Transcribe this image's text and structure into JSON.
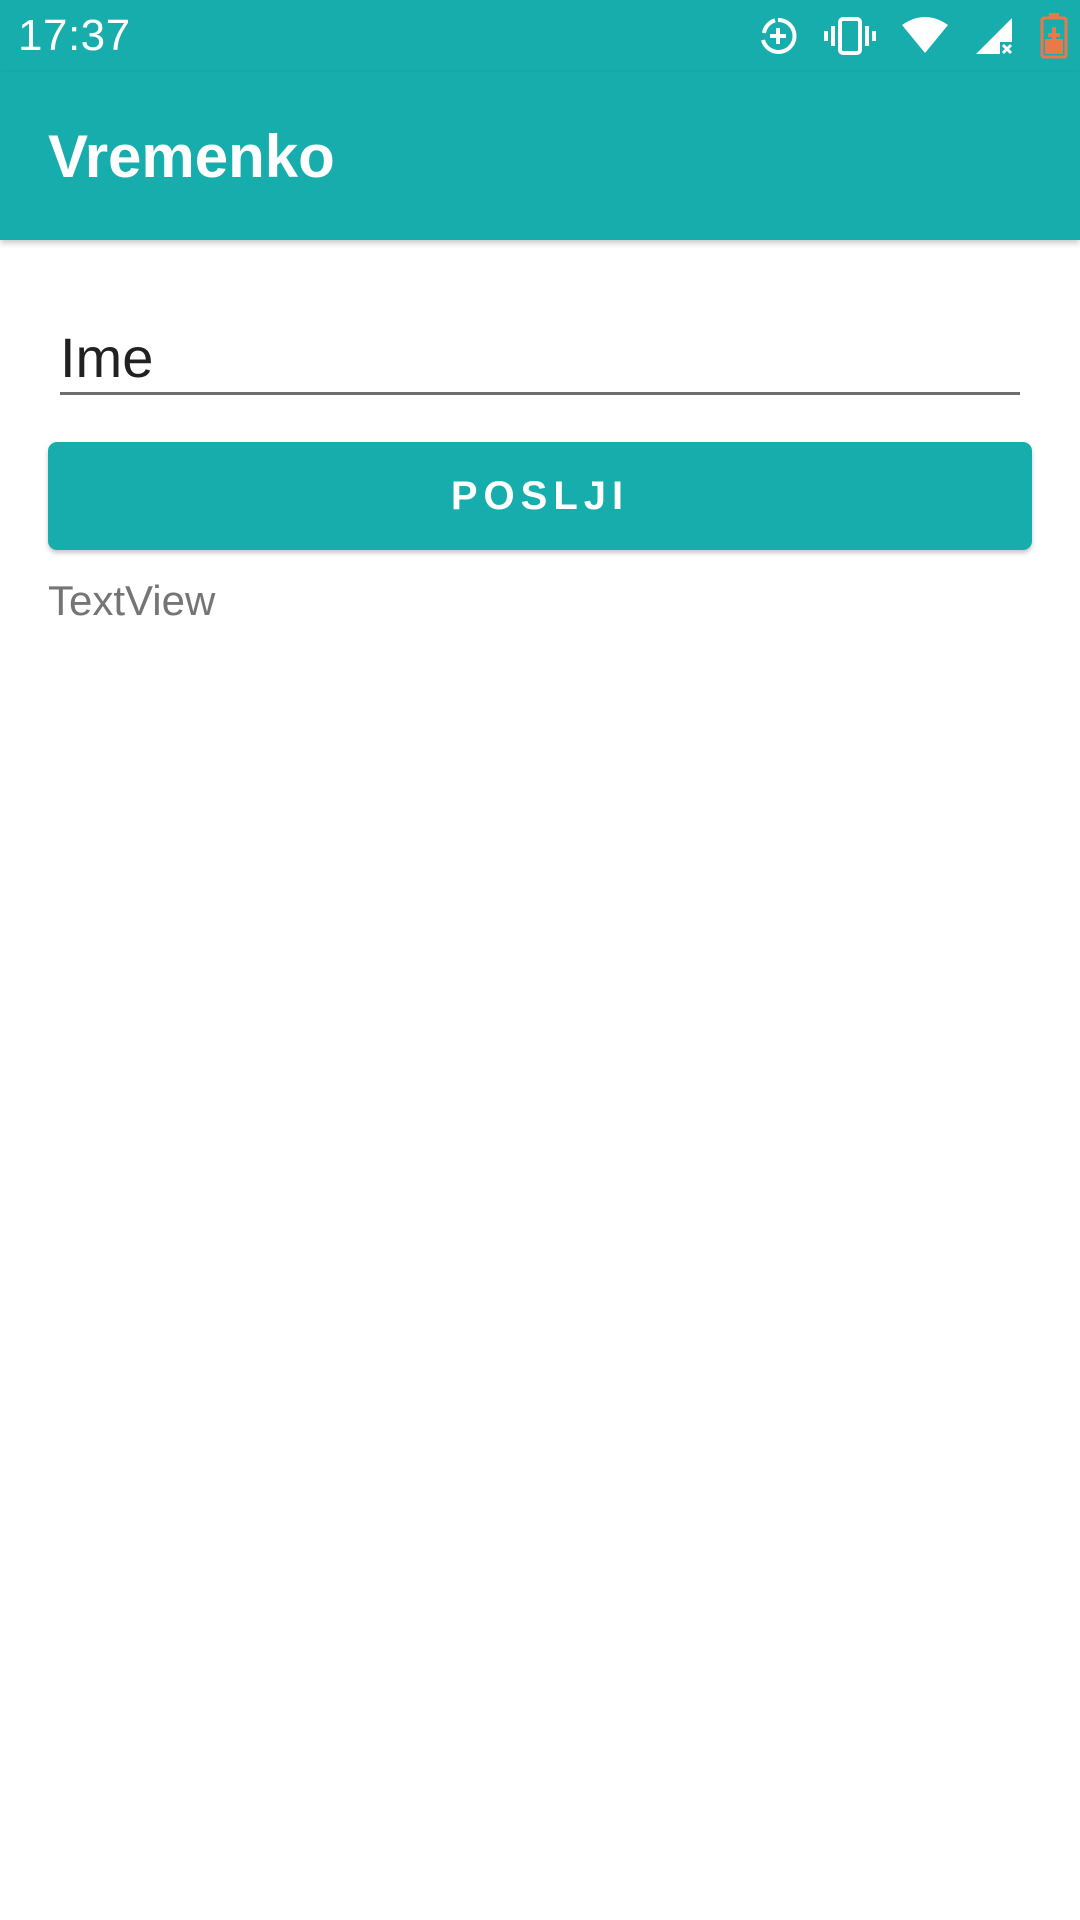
{
  "status_bar": {
    "time": "17:37",
    "icons": [
      "data-saver-icon",
      "vibrate-icon",
      "wifi-icon",
      "signal-no-data-icon",
      "battery-charging-icon"
    ],
    "battery_color": "#e9784a"
  },
  "app_bar": {
    "title": "Vremenko"
  },
  "form": {
    "name_input_placeholder": "Ime",
    "name_input_value": "",
    "send_button_label": "POSLJI",
    "result_text": "TextView"
  },
  "colors": {
    "primary": "#17adad",
    "text_primary": "#212121",
    "text_secondary": "#757575"
  }
}
